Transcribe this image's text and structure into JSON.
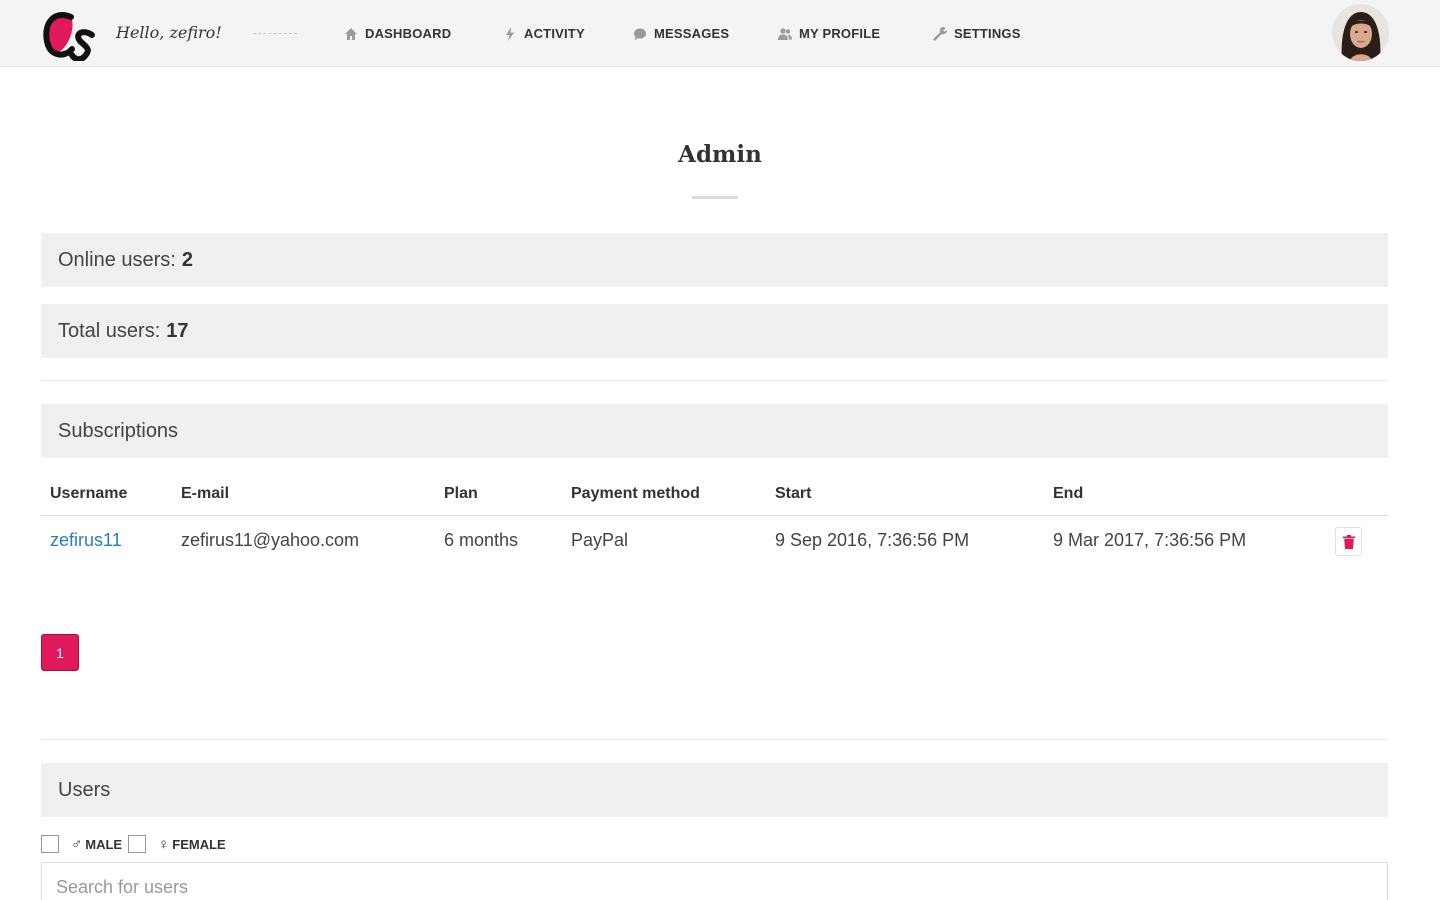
{
  "brand": {
    "accent": "#e0195c",
    "link": "#2a7bc2"
  },
  "header": {
    "greeting": "Hello, zefiro!",
    "nav": [
      {
        "label": "DASHBOARD",
        "icon": "home-icon"
      },
      {
        "label": "ACTIVITY",
        "icon": "lightning-icon"
      },
      {
        "label": "MESSAGES",
        "icon": "chat-bubble-icon"
      },
      {
        "label": "MY PROFILE",
        "icon": "users-icon"
      },
      {
        "label": "SETTINGS",
        "icon": "wrench-icon"
      }
    ]
  },
  "page": {
    "title": "Admin"
  },
  "stats": {
    "online_label": "Online users:",
    "online_value": "2",
    "total_label": "Total users:",
    "total_value": "17"
  },
  "subscriptions": {
    "title": "Subscriptions",
    "columns": [
      "Username",
      "E-mail",
      "Plan",
      "Payment method",
      "Start",
      "End"
    ],
    "rows": [
      {
        "username": "zefirus11",
        "email": "zefirus11@yahoo.com",
        "plan": "6 months",
        "payment": "PayPal",
        "start": "9 Sep 2016, 7:36:56 PM",
        "end": "9 Mar 2017, 7:36:56 PM"
      }
    ],
    "pagination": {
      "current": "1"
    }
  },
  "users": {
    "title": "Users",
    "filter_male": "MALE",
    "filter_female": "FEMALE",
    "search_placeholder": "Search for users"
  }
}
